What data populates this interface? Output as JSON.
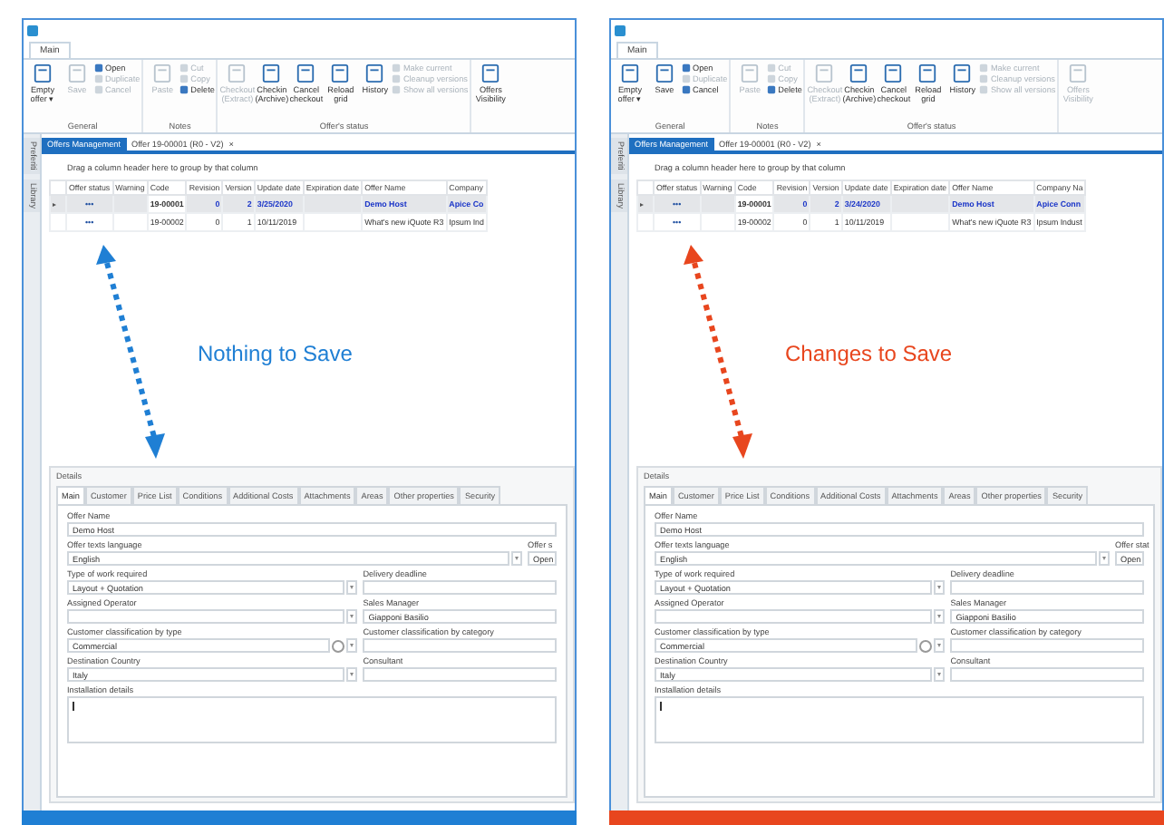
{
  "panels": [
    {
      "color": "#1f7fd4",
      "annotation": "Nothing to Save",
      "ribbon_tab": "Main",
      "side_tabs": [
        "Preferiti",
        "Library"
      ],
      "groups": [
        {
          "label": "General",
          "buttons": [
            {
              "kind": "large",
              "label": "Empty offer ▾",
              "disabled": false
            },
            {
              "kind": "large",
              "label": "Save",
              "disabled": true
            },
            {
              "kind": "small",
              "label": "Open",
              "disabled": false
            },
            {
              "kind": "small",
              "label": "Duplicate",
              "disabled": true
            },
            {
              "kind": "small",
              "label": "Cancel",
              "disabled": true
            }
          ]
        },
        {
          "label": "Notes",
          "buttons": [
            {
              "kind": "large",
              "label": "Paste",
              "disabled": true
            },
            {
              "kind": "small",
              "label": "Cut",
              "disabled": true
            },
            {
              "kind": "small",
              "label": "Copy",
              "disabled": true
            },
            {
              "kind": "small",
              "label": "Delete",
              "disabled": false
            }
          ]
        },
        {
          "label": "Offer's status",
          "buttons": [
            {
              "kind": "large",
              "label": "Checkout (Extract)",
              "disabled": true
            },
            {
              "kind": "large",
              "label": "Checkin (Archive)",
              "disabled": false
            },
            {
              "kind": "large",
              "label": "Cancel checkout",
              "disabled": false
            },
            {
              "kind": "large",
              "label": "Reload grid",
              "disabled": false
            },
            {
              "kind": "large",
              "label": "History",
              "disabled": false
            },
            {
              "kind": "small",
              "label": "Make current",
              "disabled": true
            },
            {
              "kind": "small",
              "label": "Cleanup versions",
              "disabled": true
            },
            {
              "kind": "small",
              "label": "Show all versions",
              "disabled": true
            }
          ]
        },
        {
          "buttons": [
            {
              "kind": "large",
              "label": "Offers Visibility",
              "disabled": false
            }
          ]
        }
      ],
      "doc_tabs": [
        {
          "label": "Offers Management",
          "selected": true,
          "closable": false
        },
        {
          "label": "Offer 19-00001 (R0 - V2)",
          "selected": false,
          "closable": true
        }
      ],
      "close_glyph": "×",
      "group_hint": "Drag a column header here to group by that column",
      "columns": [
        "Offer status",
        "Warning",
        "Code",
        "Revision",
        "Version",
        "Update date",
        "Expiration date",
        "Offer Name",
        "Company"
      ],
      "rows": [
        {
          "selected": true,
          "cells": [
            "•••",
            "",
            "19-00001",
            "0",
            "2",
            "3/25/2020",
            "",
            "Demo Host",
            "Apice Co"
          ]
        },
        {
          "selected": false,
          "cells": [
            "•••",
            "",
            "19-00002",
            "0",
            "1",
            "10/11/2019",
            "",
            "What's new iQuote R3",
            "Ipsum Ind"
          ]
        }
      ],
      "details": {
        "title": "Details",
        "tabs": [
          {
            "label": "Main",
            "selected": true
          },
          {
            "label": "Customer",
            "selected": false
          },
          {
            "label": "Price List",
            "selected": false
          },
          {
            "label": "Conditions",
            "selected": false
          },
          {
            "label": "Additional Costs",
            "selected": false
          },
          {
            "label": "Attachments",
            "selected": false
          },
          {
            "label": "Areas",
            "selected": false
          },
          {
            "label": "Other properties",
            "selected": false
          },
          {
            "label": "Security",
            "selected": false
          }
        ],
        "rows": [
          {
            "kind": "full",
            "fields": [
              {
                "label": "Offer Name",
                "value": "Demo Host",
                "kind": "text"
              }
            ]
          },
          {
            "kind": "wide",
            "fields": [
              {
                "label": "Offer texts language",
                "value": "English",
                "kind": "select"
              },
              {
                "label": "Offer s",
                "value": "Open",
                "kind": "text"
              }
            ]
          },
          {
            "kind": "split",
            "fields": [
              {
                "label": "Type of work required",
                "value": "Layout + Quotation",
                "kind": "select"
              },
              {
                "label": "Delivery deadline",
                "kind": "text"
              }
            ]
          },
          {
            "kind": "split",
            "fields": [
              {
                "label": "Assigned Operator",
                "kind": "select"
              },
              {
                "label": "Sales Manager",
                "value": "Giapponi Basilio",
                "kind": "text"
              }
            ]
          },
          {
            "kind": "split",
            "fields": [
              {
                "label": "Customer classification by type",
                "value": "Commercial",
                "kind": "gear-select"
              },
              {
                "label": "Customer classification by category",
                "kind": "text"
              }
            ]
          },
          {
            "kind": "split",
            "fields": [
              {
                "label": "Destination Country",
                "value": "Italy",
                "kind": "select"
              },
              {
                "label": "Consultant",
                "kind": "text"
              }
            ]
          },
          {
            "kind": "full",
            "fields": [
              {
                "label": "Installation details",
                "kind": "textarea"
              }
            ]
          }
        ]
      }
    },
    {
      "color": "#e8461e",
      "annotation": "Changes to Save",
      "ribbon_tab": "Main",
      "side_tabs": [
        "Preferiti",
        "Library"
      ],
      "groups": [
        {
          "label": "General",
          "buttons": [
            {
              "kind": "large",
              "label": "Empty offer ▾",
              "disabled": false
            },
            {
              "kind": "large",
              "label": "Save",
              "disabled": false
            },
            {
              "kind": "small",
              "label": "Open",
              "disabled": false
            },
            {
              "kind": "small",
              "label": "Duplicate",
              "disabled": true
            },
            {
              "kind": "small",
              "label": "Cancel",
              "disabled": false
            }
          ]
        },
        {
          "label": "Notes",
          "buttons": [
            {
              "kind": "large",
              "label": "Paste",
              "disabled": true
            },
            {
              "kind": "small",
              "label": "Cut",
              "disabled": true
            },
            {
              "kind": "small",
              "label": "Copy",
              "disabled": true
            },
            {
              "kind": "small",
              "label": "Delete",
              "disabled": false
            }
          ]
        },
        {
          "label": "Offer's status",
          "buttons": [
            {
              "kind": "large",
              "label": "Checkout (Extract)",
              "disabled": true
            },
            {
              "kind": "large",
              "label": "Checkin (Archive)",
              "disabled": false
            },
            {
              "kind": "large",
              "label": "Cancel checkout",
              "disabled": false
            },
            {
              "kind": "large",
              "label": "Reload grid",
              "disabled": false
            },
            {
              "kind": "large",
              "label": "History",
              "disabled": false
            },
            {
              "kind": "small",
              "label": "Make current",
              "disabled": true
            },
            {
              "kind": "small",
              "label": "Cleanup versions",
              "disabled": true
            },
            {
              "kind": "small",
              "label": "Show all versions",
              "disabled": true
            }
          ]
        },
        {
          "buttons": [
            {
              "kind": "large",
              "label": "Offers Visibility",
              "disabled": true
            }
          ]
        }
      ],
      "doc_tabs": [
        {
          "label": "Offers Management",
          "selected": true,
          "closable": false
        },
        {
          "label": "Offer 19-00001 (R0 - V2)",
          "selected": false,
          "closable": true
        }
      ],
      "close_glyph": "×",
      "group_hint": "Drag a column header here to group by that column",
      "columns": [
        "Offer status",
        "Warning",
        "Code",
        "Revision",
        "Version",
        "Update date",
        "Expiration date",
        "Offer Name",
        "Company Na"
      ],
      "rows": [
        {
          "selected": true,
          "cells": [
            "•••",
            "",
            "19-00001",
            "0",
            "2",
            "3/24/2020",
            "",
            "Demo Host",
            "Apice Conn"
          ]
        },
        {
          "selected": false,
          "cells": [
            "•••",
            "",
            "19-00002",
            "0",
            "1",
            "10/11/2019",
            "",
            "What's new iQuote R3",
            "Ipsum Indust"
          ]
        }
      ],
      "details": {
        "title": "Details",
        "tabs": [
          {
            "label": "Main",
            "selected": true
          },
          {
            "label": "Customer",
            "selected": false
          },
          {
            "label": "Price List",
            "selected": false
          },
          {
            "label": "Conditions",
            "selected": false
          },
          {
            "label": "Additional Costs",
            "selected": false
          },
          {
            "label": "Attachments",
            "selected": false
          },
          {
            "label": "Areas",
            "selected": false
          },
          {
            "label": "Other properties",
            "selected": false
          },
          {
            "label": "Security",
            "selected": false
          }
        ],
        "rows": [
          {
            "kind": "full",
            "fields": [
              {
                "label": "Offer Name",
                "value": "Demo Host",
                "kind": "text"
              }
            ]
          },
          {
            "kind": "wide",
            "fields": [
              {
                "label": "Offer texts language",
                "value": "English",
                "kind": "select"
              },
              {
                "label": "Offer stat",
                "value": "Open",
                "kind": "text"
              }
            ]
          },
          {
            "kind": "split",
            "fields": [
              {
                "label": "Type of work required",
                "value": "Layout + Quotation",
                "kind": "select"
              },
              {
                "label": "Delivery deadline",
                "kind": "text"
              }
            ]
          },
          {
            "kind": "split",
            "fields": [
              {
                "label": "Assigned Operator",
                "kind": "select"
              },
              {
                "label": "Sales Manager",
                "value": "Giapponi Basilio",
                "kind": "text"
              }
            ]
          },
          {
            "kind": "split",
            "fields": [
              {
                "label": "Customer classification by type",
                "value": "Commercial",
                "kind": "gear-select"
              },
              {
                "label": "Customer classification by category",
                "kind": "text"
              }
            ]
          },
          {
            "kind": "split",
            "fields": [
              {
                "label": "Destination Country",
                "value": "Italy",
                "kind": "select"
              },
              {
                "label": "Consultant",
                "kind": "text"
              }
            ]
          },
          {
            "kind": "full",
            "fields": [
              {
                "label": "Installation details",
                "kind": "textarea"
              }
            ]
          }
        ]
      }
    }
  ]
}
